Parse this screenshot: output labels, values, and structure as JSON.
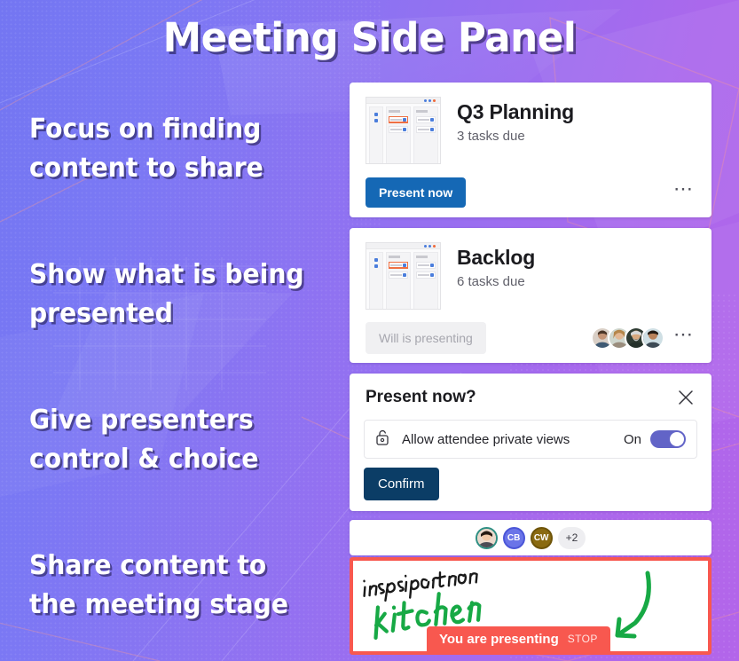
{
  "headline": "Meeting Side Panel",
  "captions": [
    "Focus on finding content to share",
    "Show what is being presented",
    "Give presenters control & choice",
    "Share content to the meeting stage"
  ],
  "colors": {
    "bg_left": "#7376f2",
    "bg_right": "#b365ea",
    "present_button": "#1568b5",
    "confirm_button": "#0b3d66",
    "toggle_on": "#6264c7",
    "presenting_red": "#f8584f",
    "ink_green": "#17a945",
    "ink_black": "#1a1a1a"
  },
  "cards": {
    "q3": {
      "title": "Q3 Planning",
      "subtitle": "3 tasks due",
      "action_label": "Present now",
      "overflow_icon": "more-horizontal-icon",
      "thumbnail_icon": "board-thumbnail-icon"
    },
    "backlog": {
      "title": "Backlog",
      "subtitle": "6 tasks due",
      "action_label": "Will is presenting",
      "overflow_icon": "more-horizontal-icon",
      "thumbnail_icon": "board-thumbnail-icon",
      "avatar_count": 4
    }
  },
  "dialog": {
    "title": "Present now?",
    "close_icon": "close-icon",
    "option": {
      "icon": "unlocked-padlock-icon",
      "label": "Allow attendee private views",
      "state": "On"
    },
    "confirm_label": "Confirm"
  },
  "presence": {
    "avatars": [
      {
        "type": "photo",
        "initials": "",
        "ring": "#2e8f83"
      },
      {
        "type": "initials",
        "initials": "CB",
        "ring": "#4b56d8"
      },
      {
        "type": "initials",
        "initials": "CW",
        "ring": "#6e5408"
      }
    ],
    "overflow_label": "+2"
  },
  "stage": {
    "ink_word_1": "inspiration",
    "ink_word_2": "kitchen",
    "arrow_icon": "curved-arrow-down-left-icon",
    "presenting_label": "You are presenting",
    "stop_label": "STOP"
  }
}
